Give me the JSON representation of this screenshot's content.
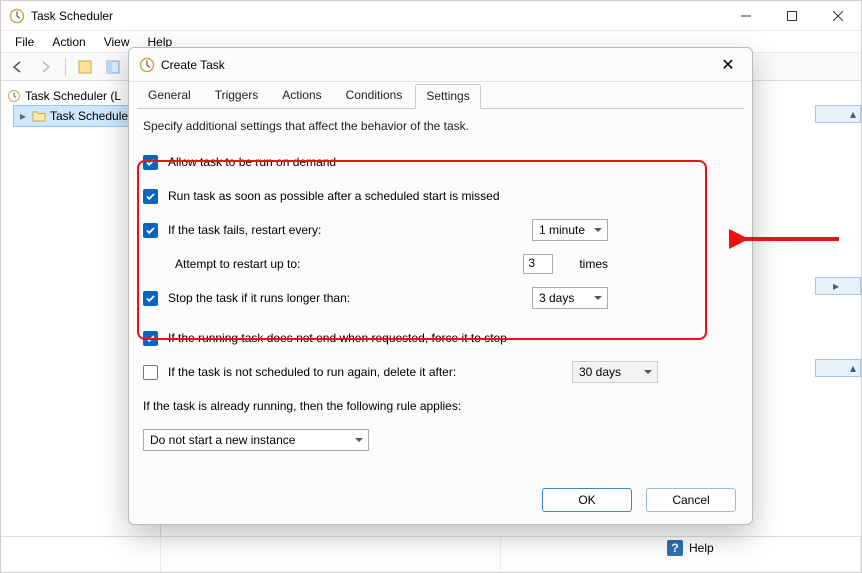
{
  "window": {
    "title": "Task Scheduler",
    "menu": {
      "file": "File",
      "action": "Action",
      "view": "View",
      "help": "Help"
    }
  },
  "tree": {
    "root": "Task Scheduler (L",
    "child": "Task Schedule"
  },
  "help_row": "Help",
  "dialog": {
    "title": "Create Task",
    "tabs": {
      "general": "General",
      "triggers": "Triggers",
      "actions": "Actions",
      "conditions": "Conditions",
      "settings": "Settings"
    },
    "active_tab": "settings",
    "desc": "Specify additional settings that affect the behavior of the task.",
    "opts": {
      "allow_demand": "Allow task to be run on demand",
      "run_asap": "Run task as soon as possible after a scheduled start is missed",
      "fail_restart": "If the task fails, restart every:",
      "restart_interval": "1 minute",
      "attempt_label": "Attempt to restart up to:",
      "attempt_value": "3",
      "attempt_suffix": "times",
      "stop_longer": "Stop the task if it runs longer than:",
      "stop_value": "3 days",
      "force_stop": "If the running task does not end when requested, force it to stop",
      "delete_after": "If the task is not scheduled to run again, delete it after:",
      "delete_value": "30 days",
      "rule_label": "If the task is already running, then the following rule applies:",
      "rule_value": "Do not start a new instance"
    },
    "checked": {
      "allow_demand": true,
      "run_asap": true,
      "fail_restart": true,
      "stop_longer": true,
      "force_stop": true,
      "delete_after": false
    },
    "buttons": {
      "ok": "OK",
      "cancel": "Cancel"
    }
  }
}
